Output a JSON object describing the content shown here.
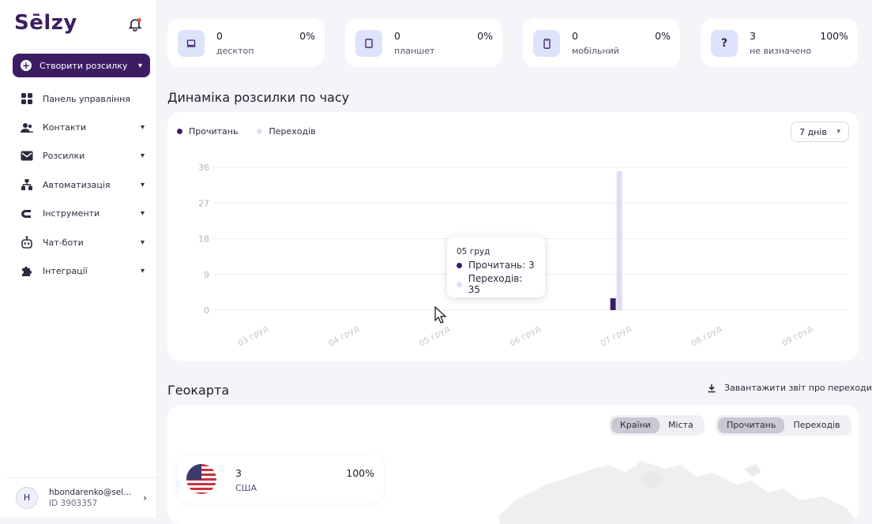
{
  "brand": {
    "logo": "Sēlzy"
  },
  "sidebar": {
    "create_button": "Створити розсилку",
    "items": [
      {
        "label": "Панель управління",
        "icon": "dashboard-icon",
        "has_submenu": false
      },
      {
        "label": "Контакти",
        "icon": "contacts-icon",
        "has_submenu": true
      },
      {
        "label": "Розсилки",
        "icon": "mail-icon",
        "has_submenu": true
      },
      {
        "label": "Автоматизація",
        "icon": "automation-icon",
        "has_submenu": true
      },
      {
        "label": "Інструменти",
        "icon": "tools-icon",
        "has_submenu": true
      },
      {
        "label": "Чат-боти",
        "icon": "bot-icon",
        "has_submenu": true
      },
      {
        "label": "Інтеграції",
        "icon": "puzzle-icon",
        "has_submenu": true
      }
    ],
    "user": {
      "initial": "H",
      "email": "hbondarenko@sel...",
      "id": "ID 3903357"
    }
  },
  "devices": [
    {
      "count": "0",
      "label": "десктоп",
      "percent": "0%",
      "icon": "desktop-icon"
    },
    {
      "count": "0",
      "label": "планшет",
      "percent": "0%",
      "icon": "tablet-icon"
    },
    {
      "count": "0",
      "label": "мобільний",
      "percent": "0%",
      "icon": "mobile-icon"
    },
    {
      "count": "3",
      "label": "не визначено",
      "percent": "100%",
      "icon": "question-icon"
    }
  ],
  "dynamics": {
    "title": "Динаміка розсилки по часу",
    "range": "7 днів",
    "legend": [
      "Прочитань",
      "Переходів"
    ]
  },
  "chart_data": {
    "type": "bar",
    "categories": [
      "03 груд",
      "04 груд",
      "05 груд",
      "06 груд",
      "07 груд",
      "08 груд",
      "09 груд"
    ],
    "series": [
      {
        "name": "Прочитань",
        "values": [
          0,
          0,
          3,
          0,
          0,
          0,
          0
        ],
        "color": "#3c1d63"
      },
      {
        "name": "Переходів",
        "values": [
          0,
          0,
          35,
          0,
          0,
          0,
          0
        ],
        "color": "#e2dcf7"
      }
    ],
    "yticks": [
      0,
      9,
      18,
      27,
      36
    ],
    "ylim": [
      0,
      36
    ],
    "grid": true,
    "legend_position": "top-left"
  },
  "tooltip": {
    "date": "05 груд",
    "read": "Прочитань: 3",
    "clicks": "Переходів: 35"
  },
  "geo": {
    "title": "Геокарта",
    "download": "Завантажити звіт про переходи",
    "scope_tabs": [
      "Країни",
      "Міста"
    ],
    "metric_tabs": [
      "Прочитань",
      "Переходів"
    ],
    "country": {
      "count": "3",
      "name": "США",
      "percent": "100%"
    }
  },
  "colors": {
    "brand": "#3c1d63",
    "accent": "#e8543a",
    "light_bar": "#e2dcf7"
  }
}
